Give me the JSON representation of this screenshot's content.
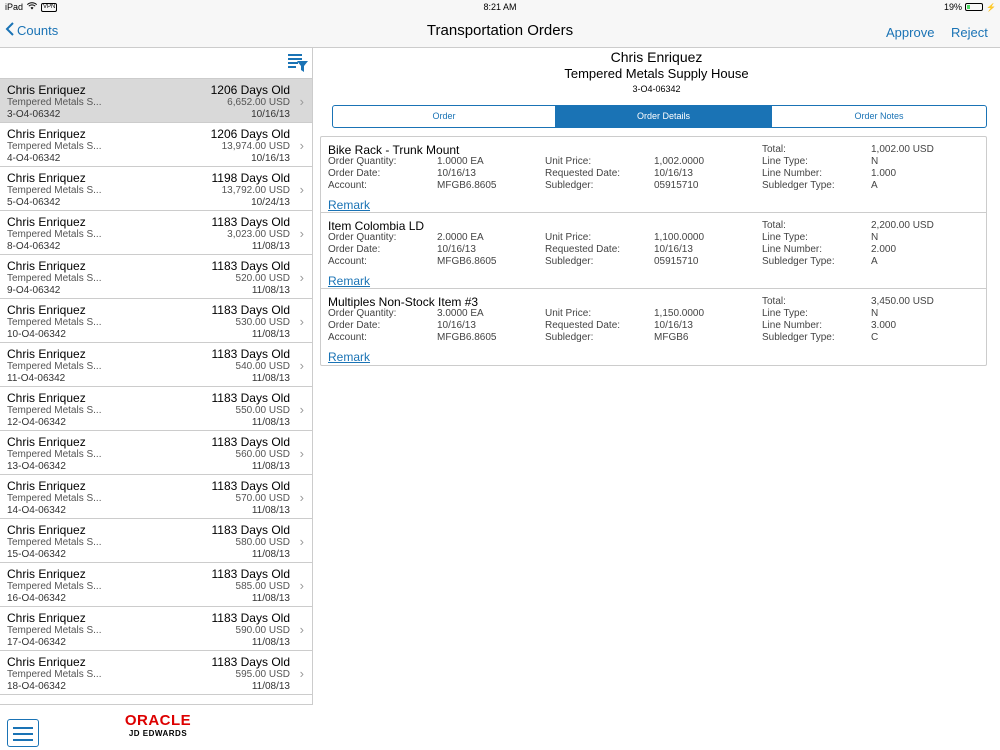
{
  "status": {
    "device": "iPad",
    "vpn": "VPN",
    "time": "8:21 AM",
    "battery": "19%",
    "battery_level": 0.19
  },
  "nav": {
    "back_label": "Counts",
    "title": "Transportation Orders",
    "approve": "Approve",
    "reject": "Reject"
  },
  "list": [
    {
      "name": "Chris Enriquez",
      "company": "Tempered Metals S...",
      "order": "3-O4-06342",
      "days": "1206 Days Old",
      "amount": "6,652.00 USD",
      "date": "10/16/13"
    },
    {
      "name": "Chris Enriquez",
      "company": "Tempered Metals S...",
      "order": "4-O4-06342",
      "days": "1206 Days Old",
      "amount": "13,974.00 USD",
      "date": "10/16/13"
    },
    {
      "name": "Chris Enriquez",
      "company": "Tempered Metals S...",
      "order": "5-O4-06342",
      "days": "1198 Days Old",
      "amount": "13,792.00 USD",
      "date": "10/24/13"
    },
    {
      "name": "Chris Enriquez",
      "company": "Tempered Metals S...",
      "order": "8-O4-06342",
      "days": "1183 Days Old",
      "amount": "3,023.00 USD",
      "date": "11/08/13"
    },
    {
      "name": "Chris Enriquez",
      "company": "Tempered Metals S...",
      "order": "9-O4-06342",
      "days": "1183 Days Old",
      "amount": "520.00 USD",
      "date": "11/08/13"
    },
    {
      "name": "Chris Enriquez",
      "company": "Tempered Metals S...",
      "order": "10-O4-06342",
      "days": "1183 Days Old",
      "amount": "530.00 USD",
      "date": "11/08/13"
    },
    {
      "name": "Chris Enriquez",
      "company": "Tempered Metals S...",
      "order": "11-O4-06342",
      "days": "1183 Days Old",
      "amount": "540.00 USD",
      "date": "11/08/13"
    },
    {
      "name": "Chris Enriquez",
      "company": "Tempered Metals S...",
      "order": "12-O4-06342",
      "days": "1183 Days Old",
      "amount": "550.00 USD",
      "date": "11/08/13"
    },
    {
      "name": "Chris Enriquez",
      "company": "Tempered Metals S...",
      "order": "13-O4-06342",
      "days": "1183 Days Old",
      "amount": "560.00 USD",
      "date": "11/08/13"
    },
    {
      "name": "Chris Enriquez",
      "company": "Tempered Metals S...",
      "order": "14-O4-06342",
      "days": "1183 Days Old",
      "amount": "570.00 USD",
      "date": "11/08/13"
    },
    {
      "name": "Chris Enriquez",
      "company": "Tempered Metals S...",
      "order": "15-O4-06342",
      "days": "1183 Days Old",
      "amount": "580.00 USD",
      "date": "11/08/13"
    },
    {
      "name": "Chris Enriquez",
      "company": "Tempered Metals S...",
      "order": "16-O4-06342",
      "days": "1183 Days Old",
      "amount": "585.00 USD",
      "date": "11/08/13"
    },
    {
      "name": "Chris Enriquez",
      "company": "Tempered Metals S...",
      "order": "17-O4-06342",
      "days": "1183 Days Old",
      "amount": "590.00 USD",
      "date": "11/08/13"
    },
    {
      "name": "Chris Enriquez",
      "company": "Tempered Metals S...",
      "order": "18-O4-06342",
      "days": "1183 Days Old",
      "amount": "595.00 USD",
      "date": "11/08/13"
    }
  ],
  "logo": {
    "brand": "ORACLE",
    "product": "JD EDWARDS"
  },
  "header": {
    "name": "Chris Enriquez",
    "company": "Tempered Metals Supply House",
    "order": "3-O4-06342"
  },
  "tabs": [
    "Order",
    "Order Details",
    "Order Notes"
  ],
  "active_tab": "Order Details",
  "labels": {
    "order_quantity": "Order Quantity:",
    "order_date": "Order Date:",
    "account": "Account:",
    "unit_price": "Unit Price:",
    "requested_date": "Requested Date:",
    "subledger": "Subledger:",
    "total": "Total:",
    "line_type": "Line Type:",
    "line_number": "Line Number:",
    "subledger_type": "Subledger Type:",
    "remark": "Remark"
  },
  "items": [
    {
      "title": "Bike Rack - Trunk Mount",
      "order_quantity": "1.0000 EA",
      "order_date": "10/16/13",
      "account": "MFGB6.8605",
      "unit_price": "1,002.0000",
      "requested_date": "10/16/13",
      "subledger": "05915710",
      "total": "1,002.00 USD",
      "line_type": "N",
      "line_number": "1.000",
      "subledger_type": "A"
    },
    {
      "title": "Item Colombia LD",
      "order_quantity": "2.0000 EA",
      "order_date": "10/16/13",
      "account": "MFGB6.8605",
      "unit_price": "1,100.0000",
      "requested_date": "10/16/13",
      "subledger": "05915710",
      "total": "2,200.00 USD",
      "line_type": "N",
      "line_number": "2.000",
      "subledger_type": "A"
    },
    {
      "title": "Multiples Non-Stock Item #3",
      "order_quantity": "3.0000 EA",
      "order_date": "10/16/13",
      "account": "MFGB6.8605",
      "unit_price": "1,150.0000",
      "requested_date": "10/16/13",
      "subledger": "MFGB6",
      "total": "3,450.00 USD",
      "line_type": "N",
      "line_number": "3.000",
      "subledger_type": "C"
    }
  ]
}
